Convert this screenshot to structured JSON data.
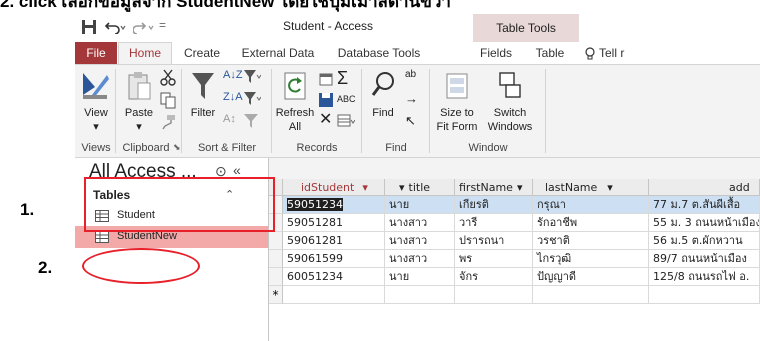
{
  "caption": "2. click เลือกข้อมูลจาก StudentNew โดยใช้ปุ่มเมาส์ด้านขวา",
  "window": {
    "title": "Student  -  Access",
    "contextual_tab_group": "Table Tools"
  },
  "tabs": [
    {
      "label": "File",
      "state": "file"
    },
    {
      "label": "Home",
      "state": "active"
    },
    {
      "label": "Create",
      "state": ""
    },
    {
      "label": "External Data",
      "state": ""
    },
    {
      "label": "Database Tools",
      "state": ""
    },
    {
      "label": "Fields",
      "state": ""
    },
    {
      "label": "Table",
      "state": ""
    },
    {
      "label": "Tell r",
      "state": "tell"
    }
  ],
  "ribbon": {
    "view": "View",
    "paste": "Paste",
    "filter": "Filter",
    "refresh": "Refresh",
    "refresh_all": "All",
    "find": "Find",
    "size_to": "Size to",
    "fit_form": "Fit Form",
    "switch": "Switch",
    "windows": "Windows",
    "groups": {
      "views": "Views",
      "clipboard": "Clipboard",
      "sort_filter": "Sort & Filter",
      "records": "Records",
      "find": "Find",
      "window": "Window"
    }
  },
  "nav": {
    "header": "All Access ...",
    "section": "Tables",
    "items": [
      "Student",
      "StudentNew"
    ]
  },
  "markers": [
    "1.",
    "2."
  ],
  "grid": {
    "columns": [
      "idStudent",
      "title",
      "firstName",
      "lastName",
      "add"
    ],
    "rows": [
      [
        "59051234",
        "นาย",
        "เกียรติ",
        "กรุณา",
        "77 ม.7 ต.สันผีเสื้อ"
      ],
      [
        "59051281",
        "นางสาว",
        "วารี",
        "รักอาชีพ",
        "55 ม. 3 ถนนหน้าเมือง"
      ],
      [
        "59061281",
        "นางสาว",
        "ปรารถนา",
        "วรชาติ",
        "56 ม.5 ต.ผักหวาน"
      ],
      [
        "59061599",
        "นางสาว",
        "พร",
        "ไกรวุฒิ",
        "89/7 ถนนหน้าเมือง"
      ],
      [
        "60051234",
        "นาย",
        "จักร",
        "ปัญญาดี",
        "125/8 ถนนรถไฟ อ."
      ]
    ],
    "new_row_marker": "*"
  },
  "colors": {
    "access_accent": "#a4373a",
    "selected_nav_item": "#f4a9a9",
    "annotation": "#e8202a"
  }
}
